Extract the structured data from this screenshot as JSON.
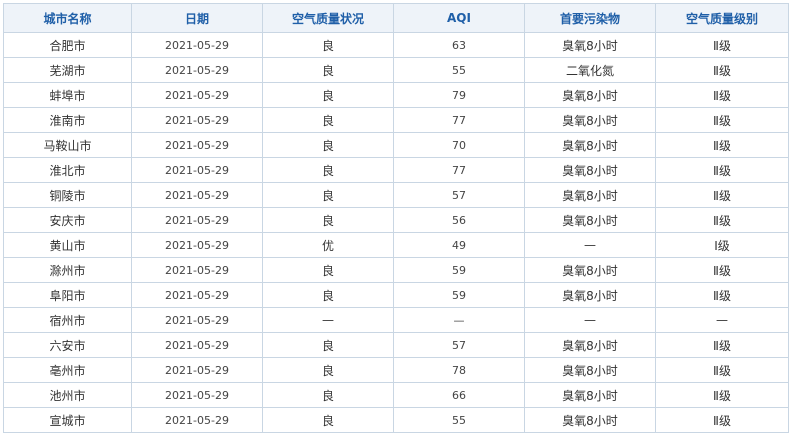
{
  "table": {
    "headers": [
      "城市名称",
      "日期",
      "空气质量状况",
      "AQI",
      "首要污染物",
      "空气质量级别"
    ],
    "rows": [
      {
        "city": "合肥市",
        "date": "2021-05-29",
        "status": "良",
        "aqi": "63",
        "pollutant": "臭氧8小时",
        "level": "Ⅱ级"
      },
      {
        "city": "芜湖市",
        "date": "2021-05-29",
        "status": "良",
        "aqi": "55",
        "pollutant": "二氧化氮",
        "level": "Ⅱ级"
      },
      {
        "city": "蚌埠市",
        "date": "2021-05-29",
        "status": "良",
        "aqi": "79",
        "pollutant": "臭氧8小时",
        "level": "Ⅱ级"
      },
      {
        "city": "淮南市",
        "date": "2021-05-29",
        "status": "良",
        "aqi": "77",
        "pollutant": "臭氧8小时",
        "level": "Ⅱ级"
      },
      {
        "city": "马鞍山市",
        "date": "2021-05-29",
        "status": "良",
        "aqi": "70",
        "pollutant": "臭氧8小时",
        "level": "Ⅱ级"
      },
      {
        "city": "淮北市",
        "date": "2021-05-29",
        "status": "良",
        "aqi": "77",
        "pollutant": "臭氧8小时",
        "level": "Ⅱ级"
      },
      {
        "city": "铜陵市",
        "date": "2021-05-29",
        "status": "良",
        "aqi": "57",
        "pollutant": "臭氧8小时",
        "level": "Ⅱ级"
      },
      {
        "city": "安庆市",
        "date": "2021-05-29",
        "status": "良",
        "aqi": "56",
        "pollutant": "臭氧8小时",
        "level": "Ⅱ级"
      },
      {
        "city": "黄山市",
        "date": "2021-05-29",
        "status": "优",
        "aqi": "49",
        "pollutant": "—",
        "level": "Ⅰ级"
      },
      {
        "city": "滁州市",
        "date": "2021-05-29",
        "status": "良",
        "aqi": "59",
        "pollutant": "臭氧8小时",
        "level": "Ⅱ级"
      },
      {
        "city": "阜阳市",
        "date": "2021-05-29",
        "status": "良",
        "aqi": "59",
        "pollutant": "臭氧8小时",
        "level": "Ⅱ级"
      },
      {
        "city": "宿州市",
        "date": "2021-05-29",
        "status": "—",
        "aqi": "—",
        "pollutant": "—",
        "level": "—"
      },
      {
        "city": "六安市",
        "date": "2021-05-29",
        "status": "良",
        "aqi": "57",
        "pollutant": "臭氧8小时",
        "level": "Ⅱ级"
      },
      {
        "city": "亳州市",
        "date": "2021-05-29",
        "status": "良",
        "aqi": "78",
        "pollutant": "臭氧8小时",
        "level": "Ⅱ级"
      },
      {
        "city": "池州市",
        "date": "2021-05-29",
        "status": "良",
        "aqi": "66",
        "pollutant": "臭氧8小时",
        "level": "Ⅱ级"
      },
      {
        "city": "宣城市",
        "date": "2021-05-29",
        "status": "良",
        "aqi": "55",
        "pollutant": "臭氧8小时",
        "level": "Ⅱ级"
      }
    ]
  }
}
